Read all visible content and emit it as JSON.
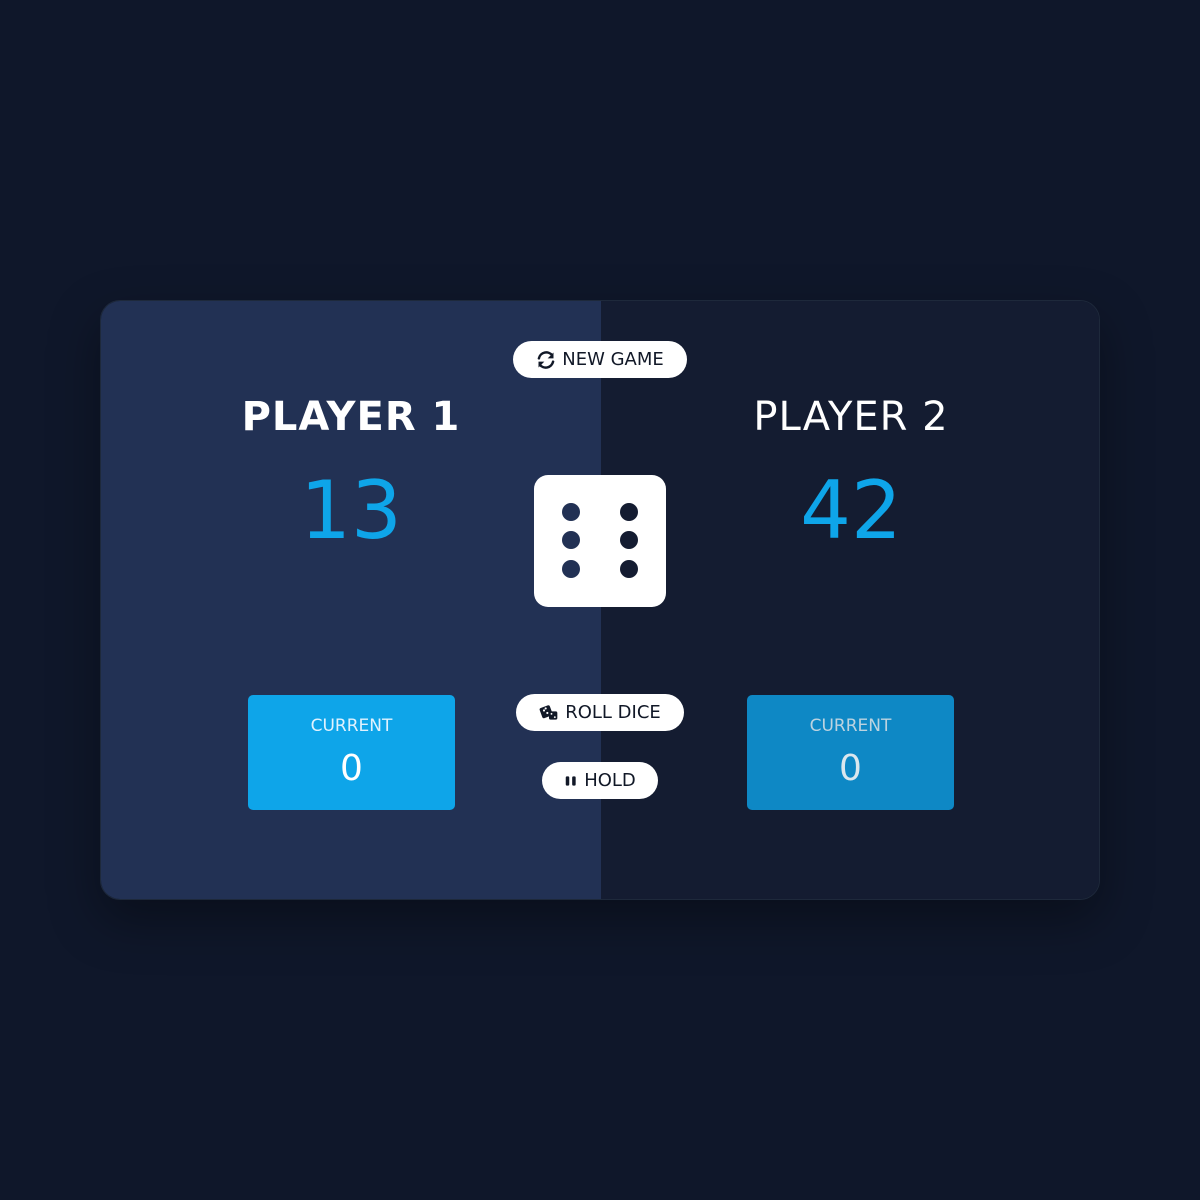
{
  "players": [
    {
      "name": "PLAYER 1",
      "score": "13",
      "current_label": "CURRENT",
      "current_score": "0",
      "active": true
    },
    {
      "name": "PLAYER 2",
      "score": "42",
      "current_label": "CURRENT",
      "current_score": "0",
      "active": false
    }
  ],
  "buttons": {
    "new_game": "NEW GAME",
    "roll_dice": "ROLL DICE",
    "hold": "HOLD"
  },
  "icons": {
    "new_game": "refresh-icon",
    "roll_dice": "dice-icon",
    "hold": "pause-icon"
  },
  "dice": {
    "value": 6
  },
  "colors": {
    "background": "#0f172a",
    "active_panel": "#223154",
    "inactive_panel": "#141c31",
    "accent": "#0ea5e9"
  }
}
